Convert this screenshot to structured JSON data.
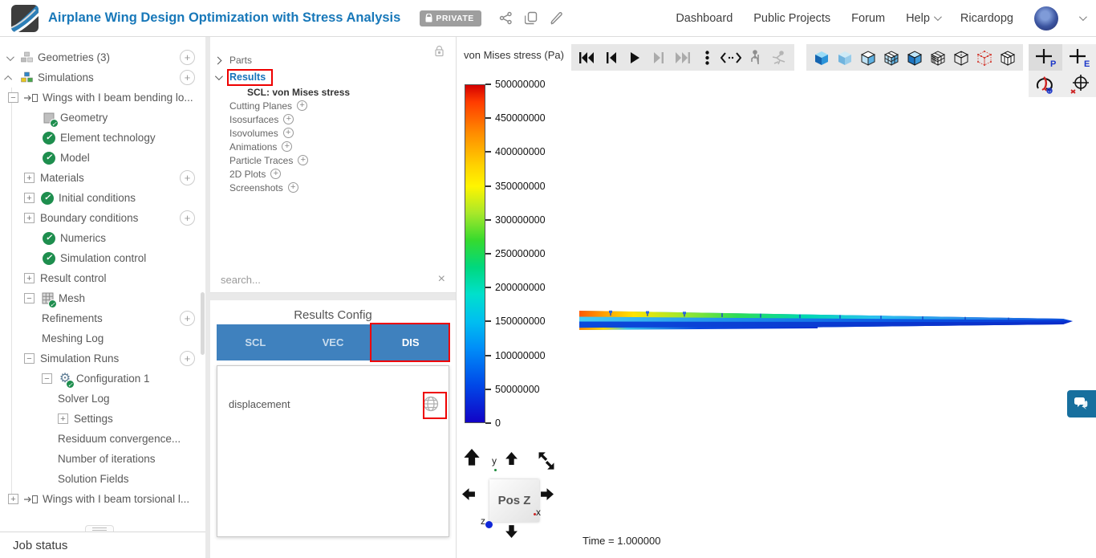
{
  "header": {
    "app_title": "Airplane Wing Design Optimization with Stress Analysis",
    "privacy_badge": "PRIVATE",
    "nav": {
      "dashboard": "Dashboard",
      "public_projects": "Public Projects",
      "forum": "Forum",
      "help": "Help",
      "username": "Ricardopg"
    }
  },
  "left_panel": {
    "tree": [
      {
        "label": "Geometries (3)",
        "cls": "cd ic-geoms plus"
      },
      {
        "label": "Simulations",
        "cls": "cu ic-sims plus"
      },
      {
        "label": "Wings with I beam bending lo...",
        "cls": "bm root2 ic-simarrow"
      },
      {
        "label": "Geometry",
        "cls": "lvl2 ic-geomchk"
      },
      {
        "label": "Element technology",
        "cls": "lvl2 ic-check"
      },
      {
        "label": "Model",
        "cls": "lvl2 ic-check"
      },
      {
        "label": "Materials",
        "cls": "bp lvl1 plus"
      },
      {
        "label": "Initial conditions",
        "cls": "bp lvl1 ic-check"
      },
      {
        "label": "Boundary conditions",
        "cls": "bp lvl1 plus"
      },
      {
        "label": "Numerics",
        "cls": "lvl2 ic-check"
      },
      {
        "label": "Simulation control",
        "cls": "lvl2 ic-check"
      },
      {
        "label": "Result control",
        "cls": "bp lvl1"
      },
      {
        "label": "Mesh",
        "cls": "bm lvl1 ic-meshchk"
      },
      {
        "label": "Refinements",
        "cls": "lvl2 plus"
      },
      {
        "label": "Meshing Log",
        "cls": "lvl2"
      },
      {
        "label": "Simulation Runs",
        "cls": "bm lvl1 plus"
      },
      {
        "label": "Configuration 1",
        "cls": "bm lvl2 ic-gearchk"
      },
      {
        "label": "Solver Log",
        "cls": "lvl3"
      },
      {
        "label": "Settings",
        "cls": "bp lvl3"
      },
      {
        "label": "Residuum convergence...",
        "cls": "lvl3"
      },
      {
        "label": "Number of iterations",
        "cls": "lvl3"
      },
      {
        "label": "Solution Fields",
        "cls": "lvl3 sel"
      },
      {
        "label": "Wings with I beam torsional l...",
        "cls": "bp root2 ic-simarrow"
      }
    ],
    "job_status_label": "Job status"
  },
  "results_panel": {
    "tree": [
      {
        "label": "Parts",
        "cls": "tall caret-r"
      },
      {
        "label": "Results",
        "cls": "tall caret-d link"
      },
      {
        "label": "SCL: von Mises stress",
        "cls": "ind2 bold"
      },
      {
        "label": "Cutting Planes",
        "cls": "addable"
      },
      {
        "label": "Isosurfaces",
        "cls": "addable"
      },
      {
        "label": "Isovolumes",
        "cls": "addable"
      },
      {
        "label": "Animations",
        "cls": "addable"
      },
      {
        "label": "Particle Traces",
        "cls": "addable"
      },
      {
        "label": "2D Plots",
        "cls": "addable"
      },
      {
        "label": "Screenshots",
        "cls": "addable"
      }
    ],
    "search_placeholder": "search...",
    "config": {
      "title": "Results Config",
      "tabs": [
        "SCL",
        "VEC",
        "DIS"
      ],
      "active_tab": "DIS",
      "fields": [
        {
          "name": "displacement"
        }
      ]
    }
  },
  "viewer": {
    "legend_title": "von Mises stress (Pa)",
    "colorbar_labels": [
      "500000000",
      "450000000",
      "400000000",
      "350000000",
      "300000000",
      "250000000",
      "200000000",
      "150000000",
      "100000000",
      "50000000",
      "0"
    ],
    "time_label": "Time = 1.000000",
    "nav_cube_label": "Pos Z",
    "axis_labels": {
      "x": "x",
      "y": "y",
      "z": "z"
    }
  },
  "colors": {
    "accent_blue": "#3f81be",
    "title_blue": "#1878b9",
    "annotation_red": "#ee0000",
    "check_green": "#1e8e4e",
    "selection_bg": "#d9eef7"
  }
}
